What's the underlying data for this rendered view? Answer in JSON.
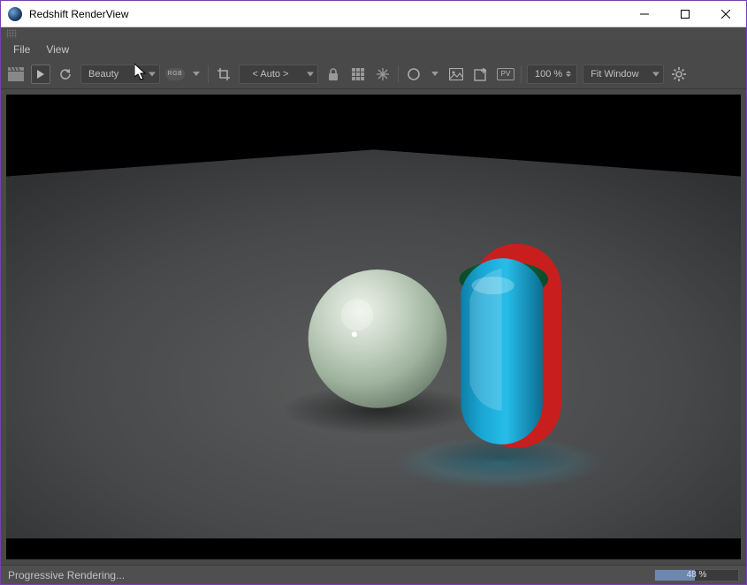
{
  "window": {
    "title": "Redshift RenderView"
  },
  "menubar": {
    "file": "File",
    "view": "View"
  },
  "toolbar": {
    "aov_selected": "Beauty",
    "rgb_label": "RGB",
    "render_region_selected": "< Auto >",
    "pv_label": "PV",
    "zoom_value": "100 %",
    "fit_selected": "Fit Window"
  },
  "status": {
    "message": "Progressive Rendering...",
    "progress_percent": 48,
    "progress_label": "48 %"
  }
}
